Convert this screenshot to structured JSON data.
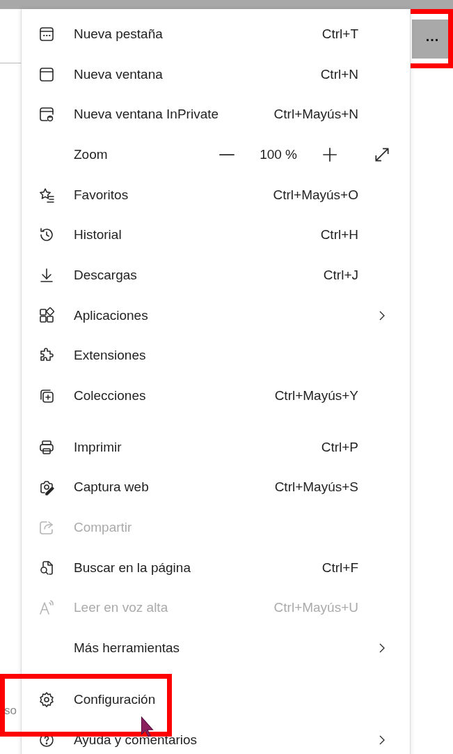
{
  "background": {
    "text_fragment": "so"
  },
  "more_button": {
    "label": "...",
    "highlighted": true
  },
  "menu_groups": [
    {
      "items": [
        {
          "kind": "item",
          "label": "Nueva pestaña",
          "shortcut": "Ctrl+T",
          "disabled": false,
          "submenu": false,
          "highlighted": false
        },
        {
          "kind": "item",
          "label": "Nueva ventana",
          "shortcut": "Ctrl+N",
          "disabled": false,
          "submenu": false,
          "highlighted": false
        },
        {
          "kind": "item",
          "label": "Nueva ventana InPrivate",
          "shortcut": "Ctrl+Mayús+N",
          "disabled": false,
          "submenu": false,
          "highlighted": false
        },
        {
          "kind": "zoom",
          "label": "Zoom",
          "value": "100 %"
        },
        {
          "kind": "item",
          "label": "Favoritos",
          "shortcut": "Ctrl+Mayús+O",
          "disabled": false,
          "submenu": false,
          "highlighted": false
        },
        {
          "kind": "item",
          "label": "Historial",
          "shortcut": "Ctrl+H",
          "disabled": false,
          "submenu": false,
          "highlighted": false
        },
        {
          "kind": "item",
          "label": "Descargas",
          "shortcut": "Ctrl+J",
          "disabled": false,
          "submenu": false,
          "highlighted": false
        },
        {
          "kind": "item",
          "label": "Aplicaciones",
          "disabled": false,
          "submenu": true,
          "highlighted": false
        },
        {
          "kind": "item",
          "label": "Extensiones",
          "disabled": false,
          "submenu": false,
          "highlighted": false
        },
        {
          "kind": "item",
          "label": "Colecciones",
          "shortcut": "Ctrl+Mayús+Y",
          "disabled": false,
          "submenu": false,
          "highlighted": false
        }
      ]
    },
    {
      "items": [
        {
          "kind": "item",
          "label": "Imprimir",
          "shortcut": "Ctrl+P",
          "disabled": false,
          "submenu": false,
          "highlighted": false
        },
        {
          "kind": "item",
          "label": "Captura web",
          "shortcut": "Ctrl+Mayús+S",
          "disabled": false,
          "submenu": false,
          "highlighted": false
        },
        {
          "kind": "item",
          "label": "Compartir",
          "disabled": true,
          "submenu": false,
          "highlighted": false
        },
        {
          "kind": "item",
          "label": "Buscar en la página",
          "shortcut": "Ctrl+F",
          "disabled": false,
          "submenu": false,
          "highlighted": false
        },
        {
          "kind": "item",
          "label": "Leer en voz alta",
          "shortcut": "Ctrl+Mayús+U",
          "disabled": true,
          "submenu": false,
          "highlighted": false
        },
        {
          "kind": "item",
          "label": "Más herramientas",
          "disabled": false,
          "submenu": true,
          "highlighted": false
        }
      ]
    },
    {
      "items": [
        {
          "kind": "item",
          "label": "Configuración",
          "disabled": false,
          "submenu": false,
          "highlighted": true
        },
        {
          "kind": "item",
          "label": "Ayuda y comentarios",
          "disabled": false,
          "submenu": true,
          "highlighted": false
        }
      ]
    }
  ]
}
